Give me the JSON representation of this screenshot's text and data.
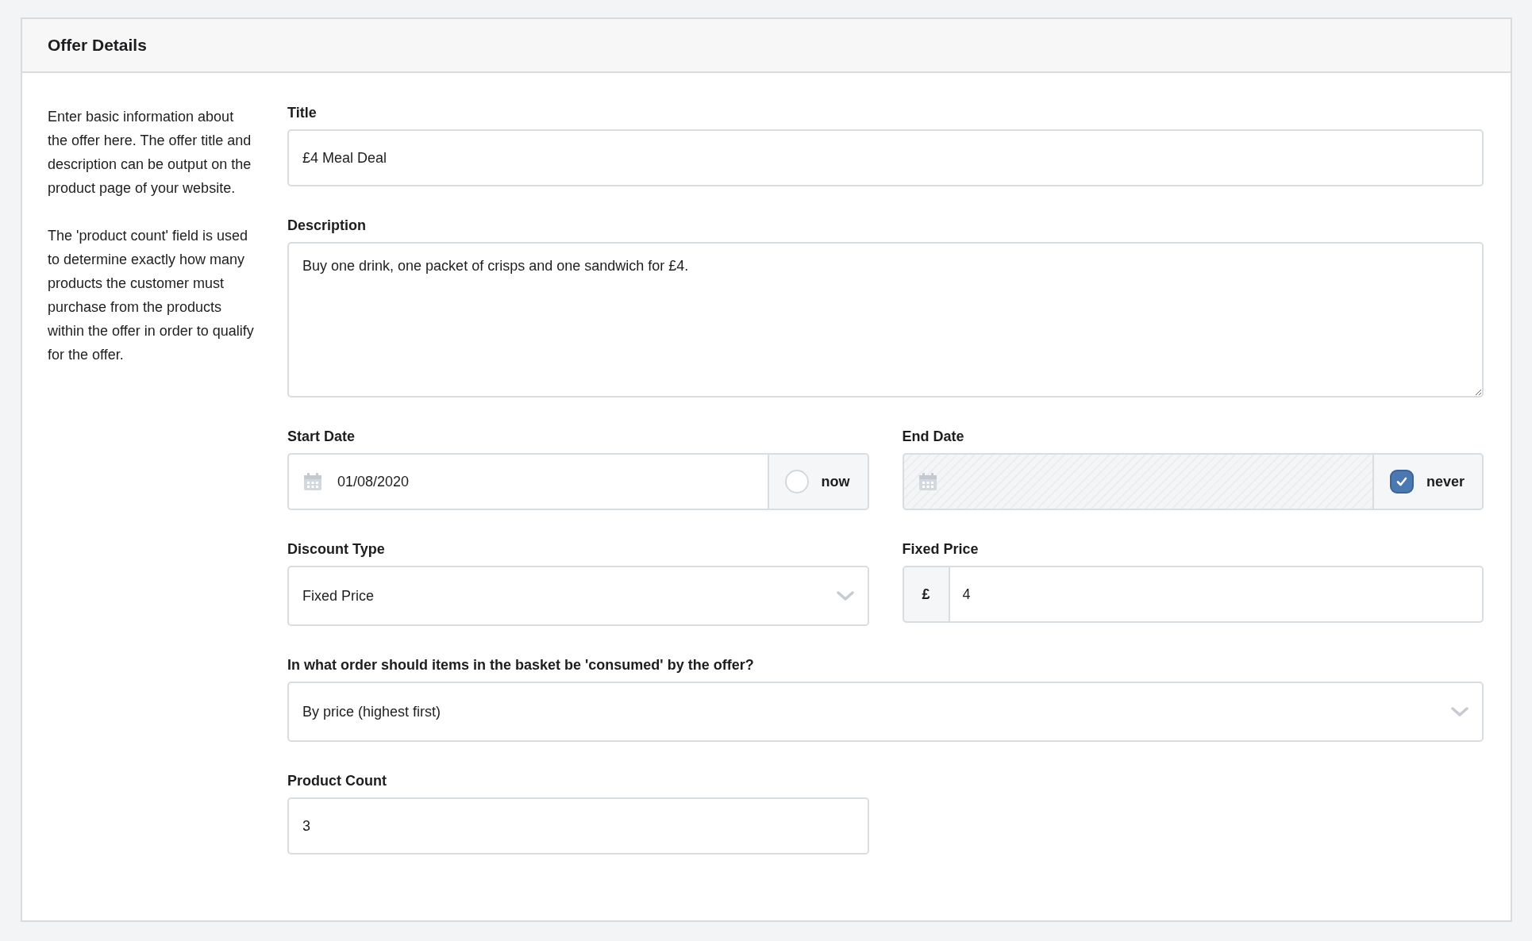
{
  "panel": {
    "title": "Offer Details"
  },
  "help": [
    "Enter basic information about the offer here. The offer title and description can be output on the product page of your website.",
    "The 'product count' field is used to determine exactly how many products the customer must purchase from the products within the offer in order to qualify for the offer."
  ],
  "rows": [
    {
      "fields": [
        {
          "kind": "text",
          "label": "Title",
          "value": "£4 Meal Deal"
        }
      ]
    },
    {
      "fields": [
        {
          "kind": "textarea",
          "label": "Description",
          "value": "Buy one drink, one packet of crisps and one sandwich for £4."
        }
      ]
    },
    {
      "fields": [
        {
          "kind": "date",
          "label": "Start Date",
          "value": "01/08/2020",
          "disabled": false,
          "toggle": {
            "label": "now",
            "checked": false
          }
        },
        {
          "kind": "date",
          "label": "End Date",
          "disabled": true,
          "toggle": {
            "label": "never",
            "checked": true
          }
        }
      ]
    },
    {
      "fields": [
        {
          "kind": "select",
          "label": "Discount Type",
          "value": "Fixed Price"
        },
        {
          "kind": "prefixed",
          "label": "Fixed Price",
          "prefix": "£",
          "value": "4"
        }
      ]
    },
    {
      "fields": [
        {
          "kind": "select",
          "label": "In what order should items in the basket be 'consumed' by the offer?",
          "value": "By price (highest first)"
        }
      ]
    },
    {
      "fields": [
        {
          "kind": "text",
          "label": "Product Count",
          "value": "3"
        },
        {
          "kind": "spacer"
        }
      ]
    }
  ]
}
